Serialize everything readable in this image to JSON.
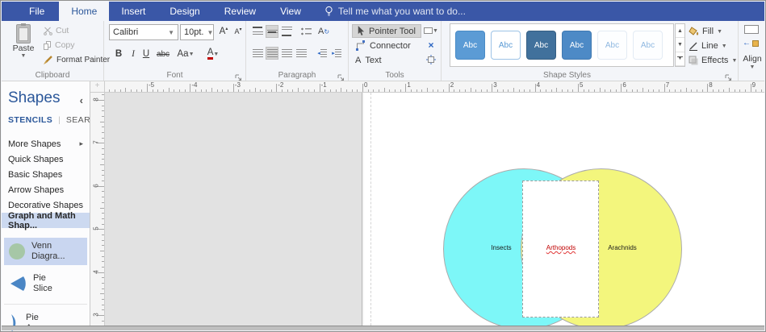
{
  "titlebar": {
    "file_tab": "File",
    "tabs": [
      "Home",
      "Insert",
      "Design",
      "Review",
      "View"
    ],
    "active_tab": "Home",
    "tell_me": "Tell me what you want to do..."
  },
  "ribbon": {
    "clipboard": {
      "label": "Clipboard",
      "paste": "Paste",
      "cut": "Cut",
      "copy": "Copy",
      "format_painter": "Format Painter"
    },
    "font": {
      "label": "Font",
      "family": "Calibri",
      "size": "10pt.",
      "bold": "B",
      "italic": "I",
      "underline": "U",
      "strike": "abc",
      "case_btn": "Aa",
      "color_btn": "A",
      "grow": "A",
      "shrink": "A"
    },
    "paragraph": {
      "label": "Paragraph"
    },
    "tools": {
      "label": "Tools",
      "pointer": "Pointer Tool",
      "connector": "Connector",
      "text": "Text",
      "text_letter": "A"
    },
    "shape_styles": {
      "label": "Shape Styles",
      "fill": "Fill",
      "line": "Line",
      "effects": "Effects",
      "swatches": [
        {
          "label": "Abc",
          "fill": "#5b9bd5",
          "text": "#ffffff",
          "border": "#4a8bc6"
        },
        {
          "label": "Abc",
          "fill": "#ffffff",
          "text": "#5b9bd5",
          "border": "#9dc3e6"
        },
        {
          "label": "Abc",
          "fill": "#41719c",
          "text": "#ffffff",
          "border": "#365f83"
        },
        {
          "label": "Abc",
          "fill": "#4d8ac6",
          "text": "#ffffff",
          "border": "#4079b1"
        },
        {
          "label": "Abc",
          "fill": "#fdfeff",
          "text": "#8fb8e0",
          "border": "#e3ebf4"
        },
        {
          "label": "Abc",
          "fill": "#fdfeff",
          "text": "#8fb8e0",
          "border": "#e3ebf4"
        }
      ]
    },
    "arrange": {
      "align": "Align"
    }
  },
  "shapes_panel": {
    "title": "Shapes",
    "collapse_icon": "‹",
    "stencils_tab": "STENCILS",
    "search_tab": "SEARCH",
    "tab_sep": "|",
    "nav_items": [
      {
        "label": "More Shapes",
        "has_arrow": true
      },
      {
        "label": "Quick Shapes"
      },
      {
        "label": "Basic Shapes"
      },
      {
        "label": "Arrow Shapes"
      },
      {
        "label": "Decorative Shapes"
      },
      {
        "label": "Graph and Math Shap...",
        "active": true
      }
    ],
    "gallery": [
      {
        "label": "Venn Diagra...",
        "icon": "venn-circle",
        "selected": true
      },
      {
        "label": "Pie Slice",
        "icon": "pie-slice"
      },
      {
        "label": "Pie Arc",
        "icon": "pie-arc"
      }
    ]
  },
  "rulers": {
    "horizontal_labels": [
      -5,
      -4,
      -3,
      -2,
      -1,
      0,
      1,
      2,
      3,
      4,
      5,
      6,
      7,
      8,
      9
    ],
    "vertical_labels": [
      8,
      7,
      6,
      5,
      4,
      3
    ]
  },
  "canvas": {
    "venn": {
      "left_label": "Insects",
      "overlap_label": "Arthopods",
      "right_label": "Arachnids",
      "left_fill": "#7df7f8",
      "right_fill": "#f3f67d",
      "overlap_text_color": "#c00000"
    }
  }
}
